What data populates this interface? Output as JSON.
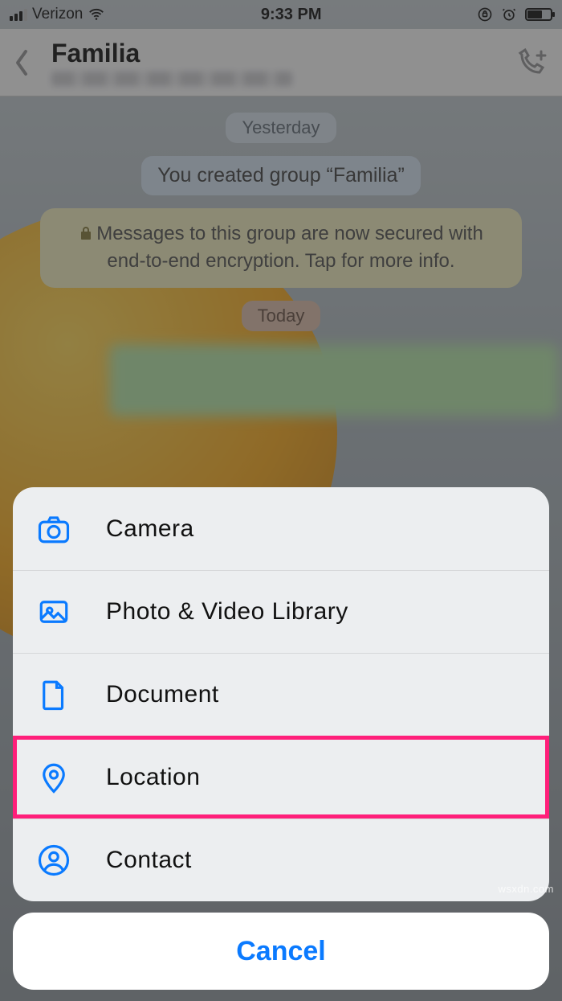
{
  "status": {
    "carrier": "Verizon",
    "time": "9:33 PM"
  },
  "nav": {
    "title": "Familia"
  },
  "chat": {
    "date_pill_1": "Yesterday",
    "system_msg": "You created group “Familia”",
    "encryption_msg": "Messages to this group are now secured with end-to-end encryption. Tap for more info.",
    "date_pill_2": "Today"
  },
  "sheet": {
    "items": [
      {
        "label": "Camera"
      },
      {
        "label": "Photo & Video Library"
      },
      {
        "label": "Document"
      },
      {
        "label": "Location"
      },
      {
        "label": "Contact"
      }
    ],
    "cancel": "Cancel"
  },
  "watermark": "wsxdn.com",
  "icons": {
    "camera": "camera-icon",
    "photo": "image-icon",
    "document": "file-icon",
    "location": "pin-icon",
    "contact": "person-circle-icon"
  },
  "colors": {
    "accent": "#0a7aff",
    "highlight": "#ff1f7a"
  }
}
